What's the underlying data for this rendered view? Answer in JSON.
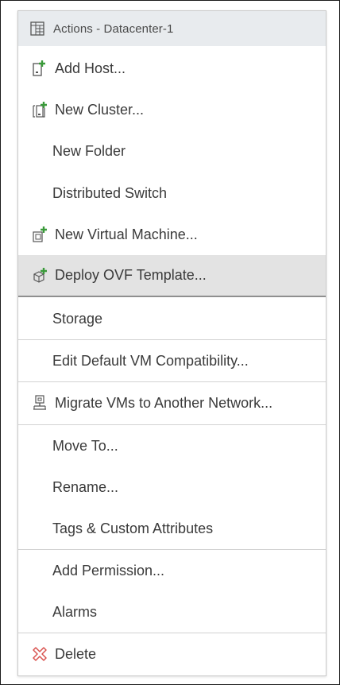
{
  "header": {
    "title": "Actions - Datacenter-1",
    "icon": "datacenter-icon"
  },
  "items": [
    {
      "label": "Add Host...",
      "icon": "add-host-icon"
    },
    {
      "label": "New Cluster...",
      "icon": "new-cluster-icon"
    },
    {
      "label": "New Folder",
      "icon": ""
    },
    {
      "label": "Distributed Switch",
      "icon": ""
    },
    {
      "label": "New Virtual Machine...",
      "icon": "new-vm-icon"
    },
    {
      "label": "Deploy OVF Template...",
      "icon": "deploy-ovf-icon",
      "state": "hover"
    },
    {
      "label": "Storage",
      "icon": ""
    },
    {
      "label": "Edit Default VM Compatibility...",
      "icon": ""
    },
    {
      "label": "Migrate VMs to Another Network...",
      "icon": "migrate-network-icon"
    },
    {
      "label": "Move To...",
      "icon": ""
    },
    {
      "label": "Rename...",
      "icon": ""
    },
    {
      "label": "Tags & Custom Attributes",
      "icon": ""
    },
    {
      "label": "Add Permission...",
      "icon": ""
    },
    {
      "label": "Alarms",
      "icon": ""
    },
    {
      "label": "Delete",
      "icon": "delete-icon"
    }
  ],
  "colors": {
    "add_accent": "#3a9a3a",
    "delete_accent": "#d9534f",
    "header_bg": "#e8ebee",
    "hover_bg": "#e3e3e3"
  }
}
